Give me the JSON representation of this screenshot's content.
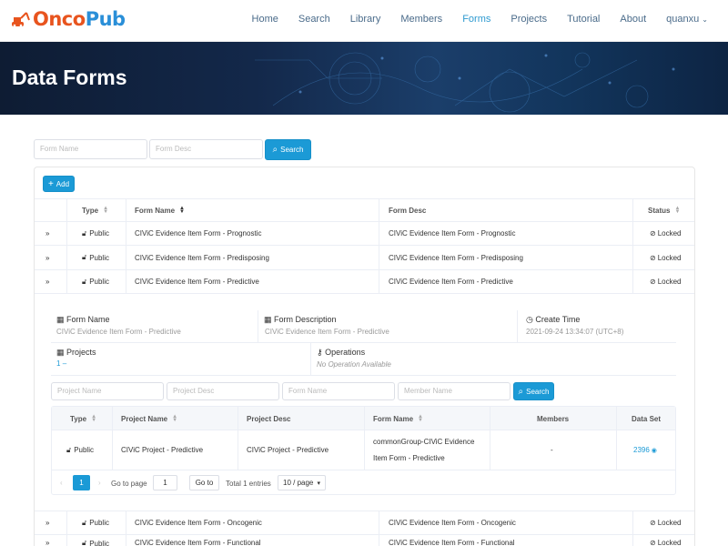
{
  "header": {
    "logo_part1": "Onco",
    "logo_part2": "Pub",
    "nav": [
      "Home",
      "Search",
      "Library",
      "Members",
      "Forms",
      "Projects",
      "Tutorial",
      "About"
    ],
    "active_nav": "Forms",
    "user": "quanxu"
  },
  "banner": {
    "title": "Data Forms"
  },
  "search": {
    "form_name_placeholder": "Form Name",
    "form_desc_placeholder": "Form Desc",
    "search_label": "Search"
  },
  "toolbar": {
    "add_label": "Add"
  },
  "table": {
    "headers": {
      "type": "Type",
      "form_name": "Form Name",
      "form_desc": "Form Desc",
      "status": "Status"
    },
    "rows": [
      {
        "type": "Public",
        "form_name": "CIViC Evidence Item Form - Prognostic",
        "form_desc": "CIViC Evidence Item Form - Prognostic",
        "status": "Locked"
      },
      {
        "type": "Public",
        "form_name": "CIViC Evidence Item Form - Predisposing",
        "form_desc": "CIViC Evidence Item Form - Predisposing",
        "status": "Locked"
      },
      {
        "type": "Public",
        "form_name": "CIViC Evidence Item Form - Predictive",
        "form_desc": "CIViC Evidence Item Form - Predictive",
        "status": "Locked"
      },
      {
        "type": "Public",
        "form_name": "CIViC Evidence Item Form - Oncogenic",
        "form_desc": "CIViC Evidence Item Form - Oncogenic",
        "status": "Locked"
      },
      {
        "type": "Public",
        "form_name": "CIViC Evidence Item Form - Functional",
        "form_desc": "CIViC Evidence Item Form - Functional",
        "status": "Locked"
      }
    ]
  },
  "detail": {
    "form_name_label": "Form Name",
    "form_name_value": "CIViC Evidence Item Form - Predictive",
    "form_desc_label": "Form Description",
    "form_desc_value": "CIViC Evidence Item Form - Predictive",
    "create_time_label": "Create Time",
    "create_time_value": "2021-09-24 13:34:07 (UTC+8)",
    "projects_label": "Projects",
    "projects_value": "1",
    "operations_label": "Operations",
    "operations_value": "No Operation Available",
    "filters": {
      "project_name_placeholder": "Project Name",
      "project_desc_placeholder": "Project Desc",
      "form_name_placeholder": "Form Name",
      "member_name_placeholder": "Member Name",
      "search_label": "Search"
    },
    "inner_table": {
      "headers": {
        "type": "Type",
        "project_name": "Project Name",
        "project_desc": "Project Desc",
        "form_name": "Form Name",
        "members": "Members",
        "data_set": "Data Set"
      },
      "row": {
        "type": "Public",
        "project_name": "CIViC Project - Predictive",
        "project_desc": "CIViC Project - Predictive",
        "form_name_line1": "commonGroup-CIViC Evidence",
        "form_name_line2": "Item Form - Predictive",
        "members": "-",
        "data_set": "2396"
      }
    },
    "pagination": {
      "current_page": "1",
      "goto_label": "Go to page",
      "goto_value": "1",
      "goto_button": "Go to",
      "total": "Total 1 entries",
      "page_size": "10 / page"
    }
  },
  "colors": {
    "accent": "#1b9ad6",
    "nav_active": "#2e9ad0",
    "banner_dark": "#0e1c33"
  }
}
